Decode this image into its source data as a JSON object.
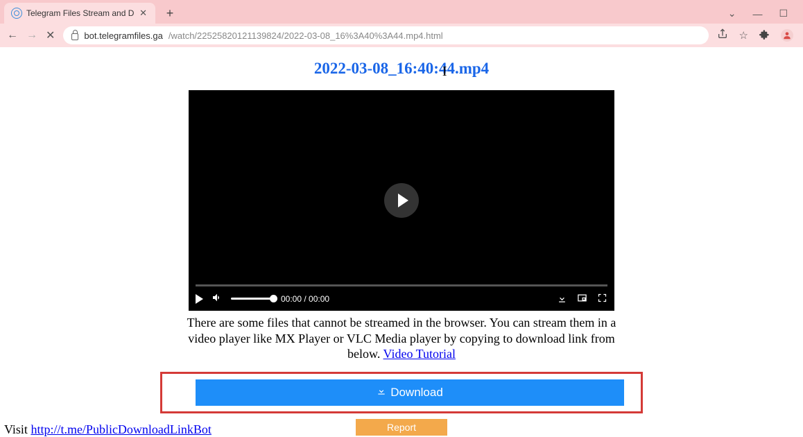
{
  "browser": {
    "tab_title": "Telegram Files Stream and Down",
    "url_host": "bot.telegramfiles.ga",
    "url_path": "/watch/22525820121139824/2022-03-08_16%3A40%3A44.mp4.html"
  },
  "page": {
    "file_title": "2022-03-08_16:40:44.mp4",
    "video": {
      "time_current": "00:00",
      "time_total": "00:00"
    },
    "note_text_1": "There are some files that cannot be streamed in the browser. You can stream them in a video player like MX Player or VLC Media player by copying to download link from below. ",
    "tutorial_link": "Video Tutorial",
    "download_label": "Download",
    "report_label": "Report",
    "footer_prefix": "Visit ",
    "footer_link": "http://t.me/PublicDownloadLinkBot"
  }
}
